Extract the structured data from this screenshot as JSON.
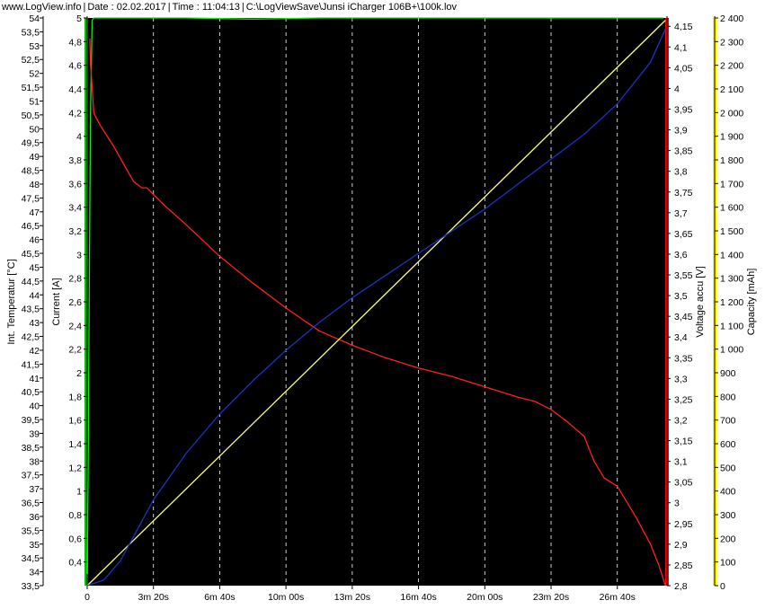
{
  "header": {
    "site": "www.LogView.info",
    "date": "Date : 02.02.2017",
    "time": "Time : 11:04:13",
    "file": "C:\\LogViewSave\\Junsi iCharger 106B+\\100k.lov"
  },
  "colors": {
    "plot_bg": "#000000",
    "grid": "#ffffff",
    "temperature": "#000000",
    "current": "#00c000",
    "voltage": "#ff0000",
    "capacity": "#ffff00",
    "voltage_curve": "#ff2020",
    "current_curve": "#20e020",
    "capacity_curve": "#ffff80",
    "temperature_curve": "#2030c0"
  },
  "chart_data": {
    "type": "line",
    "x_label": "",
    "x_ticks": [
      "0",
      "3m 20s",
      "6m 40s",
      "10m 00s",
      "13m 20s",
      "16m 40s",
      "20m 00s",
      "23m 20s",
      "26m 40s"
    ],
    "x_range_seconds": [
      0,
      1750
    ],
    "grid": "vertical dashed",
    "axes": [
      {
        "id": "temp",
        "label": "Int. Temperatur [°C]",
        "side": "left-outer",
        "color": "#000000",
        "range": [
          33.5,
          54
        ],
        "ticks": [
          "54",
          "53,5",
          "53",
          "52,5",
          "52",
          "51,5",
          "51",
          "50,5",
          "50",
          "49,5",
          "49",
          "48,5",
          "48",
          "47,5",
          "47",
          "46,5",
          "46",
          "45,5",
          "45",
          "44,5",
          "44",
          "43,5",
          "43",
          "42,5",
          "42",
          "41,5",
          "41",
          "40,5",
          "40",
          "39,5",
          "39",
          "38,5",
          "38",
          "37,5",
          "37",
          "36,5",
          "36",
          "35,5",
          "35",
          "34,5",
          "34",
          "33,5"
        ]
      },
      {
        "id": "current",
        "label": "Current [A]",
        "side": "left-inner",
        "color": "#00c000",
        "range": [
          0.2,
          5
        ],
        "ticks": [
          "5",
          "4,8",
          "4,6",
          "4,4",
          "4,2",
          "4",
          "3,8",
          "3,6",
          "3,4",
          "3,2",
          "3",
          "2,8",
          "2,6",
          "2,4",
          "2,2",
          "2",
          "1,8",
          "1,6",
          "1,4",
          "1,2",
          "1",
          "0,8",
          "0,6",
          "0,4"
        ]
      },
      {
        "id": "voltage",
        "label": "Voltage accu [V]",
        "side": "right-inner",
        "color": "#ff0000",
        "range": [
          2.8,
          4.17
        ],
        "ticks": [
          "4,15",
          "4,1",
          "4,05",
          "4",
          "3,95",
          "3,9",
          "3,85",
          "3,8",
          "3,75",
          "3,7",
          "3,65",
          "3,6",
          "3,55",
          "3,5",
          "3,45",
          "3,4",
          "3,35",
          "3,3",
          "3,25",
          "3,2",
          "3,15",
          "3,1",
          "3,05",
          "3",
          "2,95",
          "2,9",
          "2,85",
          "2,8"
        ]
      },
      {
        "id": "capacity",
        "label": "Capacity [mAh]",
        "side": "right-outer",
        "color": "#ffff00",
        "range": [
          0,
          2400
        ],
        "ticks": [
          "2 400",
          "2 300",
          "2 200",
          "2 100",
          "2 000",
          "1 900",
          "1 800",
          "1 700",
          "1 600",
          "1 500",
          "1 400",
          "1 300",
          "1 200",
          "1 100",
          "1 000",
          "900",
          "800",
          "700",
          "600",
          "500",
          "400",
          "300",
          "200",
          "100",
          "0"
        ]
      }
    ],
    "series": [
      {
        "axis": "current",
        "x": [
          0,
          3,
          6,
          10,
          15,
          20,
          100,
          300,
          500,
          700,
          900,
          1100,
          1300,
          1500,
          1700,
          1740
        ],
        "y": [
          0.3,
          1.2,
          2.6,
          4.2,
          4.98,
          5.0,
          5.0,
          5.0,
          4.99,
          5.0,
          5.0,
          5.0,
          5.0,
          5.0,
          5.0,
          5.0
        ]
      },
      {
        "axis": "voltage",
        "x": [
          8,
          10,
          20,
          40,
          80,
          140,
          165,
          180,
          230,
          300,
          400,
          500,
          600,
          700,
          800,
          900,
          1000,
          1100,
          1200,
          1300,
          1350,
          1400,
          1450,
          1500,
          1530,
          1560,
          1600,
          1630,
          1660,
          1700,
          1725,
          1745
        ],
        "y": [
          4.12,
          4.06,
          3.94,
          3.91,
          3.86,
          3.775,
          3.76,
          3.76,
          3.72,
          3.67,
          3.595,
          3.53,
          3.47,
          3.415,
          3.38,
          3.35,
          3.325,
          3.305,
          3.28,
          3.255,
          3.245,
          3.225,
          3.195,
          3.16,
          3.1,
          3.06,
          3.04,
          3.0,
          2.96,
          2.9,
          2.85,
          2.8
        ]
      },
      {
        "axis": "capacity",
        "x": [
          0,
          1745
        ],
        "y": [
          0,
          2390
        ]
      },
      {
        "axis": "temp",
        "x": [
          0,
          50,
          100,
          200,
          300,
          400,
          500,
          600,
          700,
          800,
          900,
          1000,
          1100,
          1200,
          1300,
          1400,
          1500,
          1600,
          1700,
          1745
        ],
        "y": [
          33.5,
          33.7,
          34.4,
          36.6,
          38.3,
          39.7,
          40.9,
          42.0,
          43.0,
          43.9,
          44.7,
          45.5,
          46.3,
          47.1,
          48.0,
          48.9,
          49.8,
          50.9,
          52.4,
          53.6
        ]
      }
    ]
  }
}
